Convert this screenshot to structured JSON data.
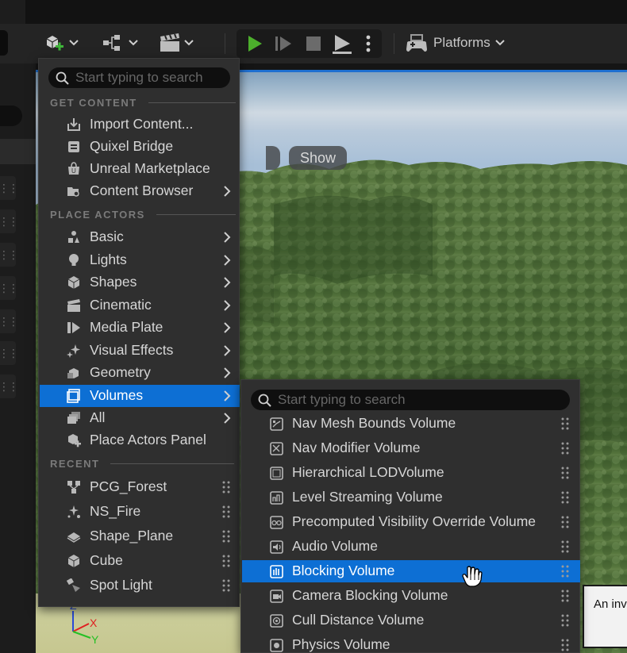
{
  "toolbar": {
    "platforms_label": "Platforms"
  },
  "viewport": {
    "show_label": "Show",
    "tooltip_text": "An inv",
    "gizmo_axes": {
      "z": "Z",
      "x": "X",
      "y": "Y"
    }
  },
  "main_menu": {
    "search_placeholder": "Start typing to search",
    "sections": {
      "get_content": "GET CONTENT",
      "place_actors": "PLACE ACTORS",
      "recent": "RECENT"
    },
    "get_content_items": [
      {
        "label": "Import Content...",
        "icon": "import-icon"
      },
      {
        "label": "Quixel Bridge",
        "icon": "quixel-bridge-icon"
      },
      {
        "label": "Unreal Marketplace",
        "icon": "marketplace-icon"
      },
      {
        "label": "Content Browser",
        "icon": "content-browser-icon",
        "submenu": true
      }
    ],
    "place_actor_items": [
      {
        "label": "Basic",
        "icon": "basic-actors-icon",
        "submenu": true
      },
      {
        "label": "Lights",
        "icon": "light-bulb-icon",
        "submenu": true
      },
      {
        "label": "Shapes",
        "icon": "cube-icon",
        "submenu": true
      },
      {
        "label": "Cinematic",
        "icon": "clapperboard-icon",
        "submenu": true
      },
      {
        "label": "Media Plate",
        "icon": "media-plate-icon",
        "submenu": true
      },
      {
        "label": "Visual Effects",
        "icon": "sparkles-icon",
        "submenu": true
      },
      {
        "label": "Geometry",
        "icon": "geometry-icon",
        "submenu": true
      },
      {
        "label": "Volumes",
        "icon": "volume-icon",
        "submenu": true,
        "selected": true
      },
      {
        "label": "All",
        "icon": "all-actors-icon",
        "submenu": true
      },
      {
        "label": "Place Actors Panel",
        "icon": "place-actors-panel-icon"
      }
    ],
    "recent_items": [
      {
        "label": "PCG_Forest",
        "icon": "pcg-icon"
      },
      {
        "label": "NS_Fire",
        "icon": "niagara-icon"
      },
      {
        "label": "Shape_Plane",
        "icon": "plane-icon"
      },
      {
        "label": "Cube",
        "icon": "cube-icon"
      },
      {
        "label": "Spot Light",
        "icon": "spot-light-icon"
      }
    ]
  },
  "volumes_submenu": {
    "search_placeholder": "Start typing to search",
    "items": [
      {
        "label": "Nav Mesh Bounds Volume",
        "icon": "nav-mesh-icon"
      },
      {
        "label": "Nav Modifier Volume",
        "icon": "nav-modifier-icon"
      },
      {
        "label": "Hierarchical LODVolume",
        "icon": "hlod-volume-icon"
      },
      {
        "label": "Level Streaming Volume",
        "icon": "level-streaming-icon"
      },
      {
        "label": "Precomputed Visibility Override Volume",
        "icon": "visibility-override-icon"
      },
      {
        "label": "Audio Volume",
        "icon": "audio-volume-icon"
      },
      {
        "label": "Blocking Volume",
        "icon": "blocking-volume-icon",
        "selected": true
      },
      {
        "label": "Camera Blocking Volume",
        "icon": "camera-blocking-icon"
      },
      {
        "label": "Cull Distance Volume",
        "icon": "cull-distance-icon"
      },
      {
        "label": "Physics Volume",
        "icon": "physics-volume-icon"
      }
    ]
  },
  "colors": {
    "selection": "#0d6fd4",
    "menu_bg": "#2f2f2f",
    "play_green": "#4caf2c"
  }
}
